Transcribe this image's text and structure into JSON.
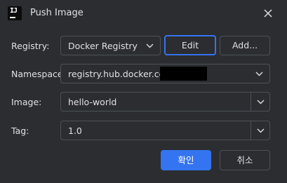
{
  "window": {
    "title": "Push Image",
    "app_icon": "intellij-idea-icon",
    "close_icon": "close-icon"
  },
  "form": {
    "registry": {
      "label": "Registry:",
      "value": "Docker Registry"
    },
    "namespace": {
      "label": "Namespace:",
      "value": "registry.hub.docker.com/"
    },
    "image": {
      "label": "Image:",
      "value": "hello-world"
    },
    "tag": {
      "label": "Tag:",
      "value": "1.0"
    }
  },
  "buttons": {
    "edit": "Edit",
    "add": "Add...",
    "ok": "확인",
    "cancel": "취소"
  },
  "app_icon_text": "IJ",
  "colors": {
    "background": "#2b2d30",
    "border": "#4e5157",
    "accent": "#3574f0",
    "text": "#dfe1e5"
  }
}
